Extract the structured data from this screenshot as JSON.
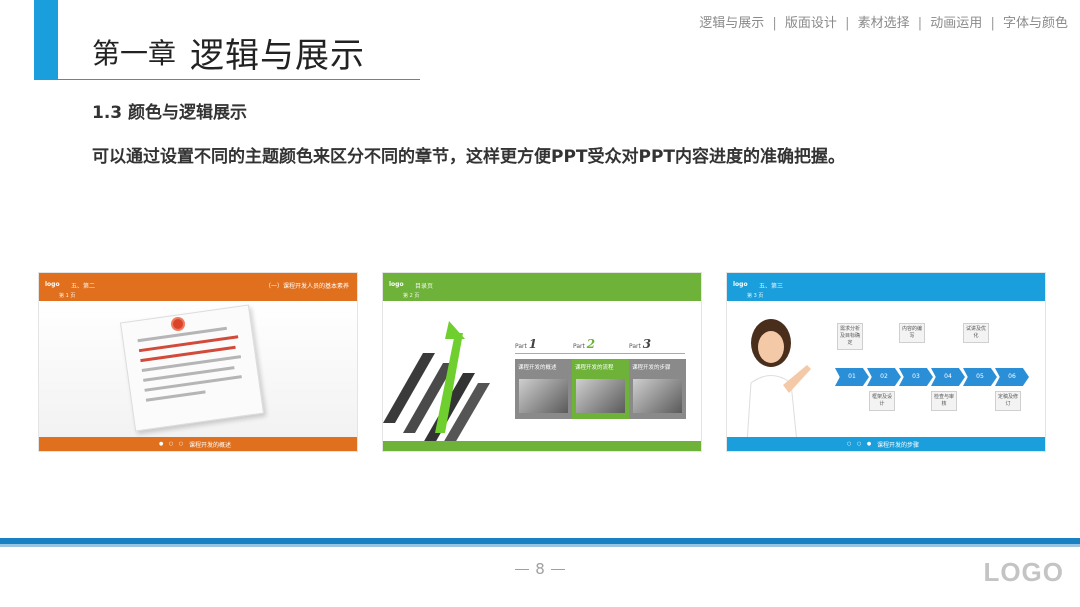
{
  "header": {
    "chapter_label": "第一章",
    "chapter_title": "逻辑与展示",
    "nav": [
      "逻辑与展示",
      "版面设计",
      "素材选择",
      "动画运用",
      "字体与颜色"
    ],
    "nav_separator": "|",
    "accent_color": "#1a9fdc"
  },
  "content": {
    "section_heading": "1.3 颜色与逻辑展示",
    "description": "可以通过设置不同的主题颜色来区分不同的章节，这样更方便PPT受众对PPT内容进度的准确把握。"
  },
  "thumbnails": [
    {
      "theme_color": "#e0701d",
      "logo_text": "logo",
      "crumb": "五、第二",
      "sub": "第 1 页",
      "right_title": "（一）课程开发人员的基本素养",
      "footer_dots": "● ○ ○",
      "footer_caption": "课程开发的概述"
    },
    {
      "theme_color": "#6fb23a",
      "logo_text": "logo",
      "crumb": "目录页",
      "sub": "第 2 页",
      "parts": [
        {
          "prefix": "Part",
          "number": "1",
          "label": "课程开发的概述"
        },
        {
          "prefix": "Part",
          "number": "2",
          "label": "课程开发的流程"
        },
        {
          "prefix": "Part",
          "number": "3",
          "label": "课程开发的步骤"
        }
      ]
    },
    {
      "theme_color": "#1a9fdc",
      "logo_text": "logo",
      "crumb": "五、第三",
      "sub": "第 3 页",
      "steps": [
        "01",
        "02",
        "03",
        "04",
        "05",
        "06"
      ],
      "top_boxes": [
        "需求分析及目标确定",
        "内容的编写",
        "试讲及优化"
      ],
      "bottom_boxes": [
        "框架及设计",
        "检查与审核",
        "定稿及修订"
      ],
      "footer_dots": "○ ○ ●",
      "footer_caption": "课程开发的步骤"
    }
  ],
  "footer": {
    "page_number": "8",
    "logo": "LOGO",
    "band_color": "#1a80c4"
  }
}
